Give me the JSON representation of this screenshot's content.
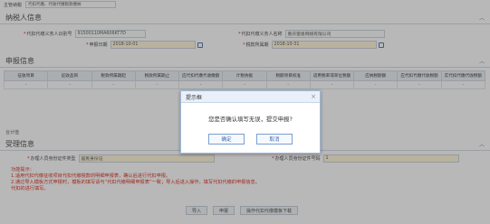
{
  "top": {
    "select_label": "主管纳税",
    "select_value": "代扣代缴、代收代缴税款缴纳",
    "select_value_2": ""
  },
  "taxpayer": {
    "title": "纳税人信息",
    "id_label": "代扣代缴义务人识别号",
    "id_value": "91500110MA606KT7D",
    "name_label": "代扣代缴义务人名称",
    "name_value": "重庆雷恩网络有限公司",
    "period_start_label": "申报日期",
    "period_end_label": "税款所属期",
    "period_start_value": "2018-10-01",
    "period_end_value": "2018-10-31"
  },
  "declare": {
    "title": "申报信息",
    "columns": [
      "征收项目",
      "征收品目",
      "税款所属期起",
      "税款所属期止",
      "应代扣代缴代收缴额",
      "计税依据",
      "税额项目标准",
      "适用税率或单位税额",
      "应纳税额额",
      "应代扣代缴代收税额",
      "实代扣代缴代收税额"
    ],
    "rows": [
      [
        "-",
        "-",
        "-",
        "-",
        "-",
        "-",
        "-",
        "-",
        "-",
        "-",
        "-"
      ]
    ],
    "total_label": "合计值"
  },
  "accept": {
    "title": "受理信息",
    "handler_label": "办理人员身份证件类型",
    "handler_value": "居民身份证",
    "handler_no_label": "办理人员身份证件号码",
    "handler_no_value": "1"
  },
  "tips": {
    "title": "功能提示：",
    "line1": "1.适用代扣代缴征收项目代扣代缴税款的明细申报表，确认后进行代扣申报。",
    "line2": "2.通过导入模板方式申报时，模板的填写请与“代扣代缴明细申报表”一致；导入后进入操作，填写代扣代缴的申报信息。",
    "line3": "代扣的进行填写。"
  },
  "buttons": {
    "import": "导入",
    "declare": "申报",
    "template": "操作代扣代缴模板下载"
  },
  "modal": {
    "title": "提示框",
    "message": "您是否确认填写无误，提交申报?",
    "confirm": "确定",
    "cancel": "取消"
  }
}
